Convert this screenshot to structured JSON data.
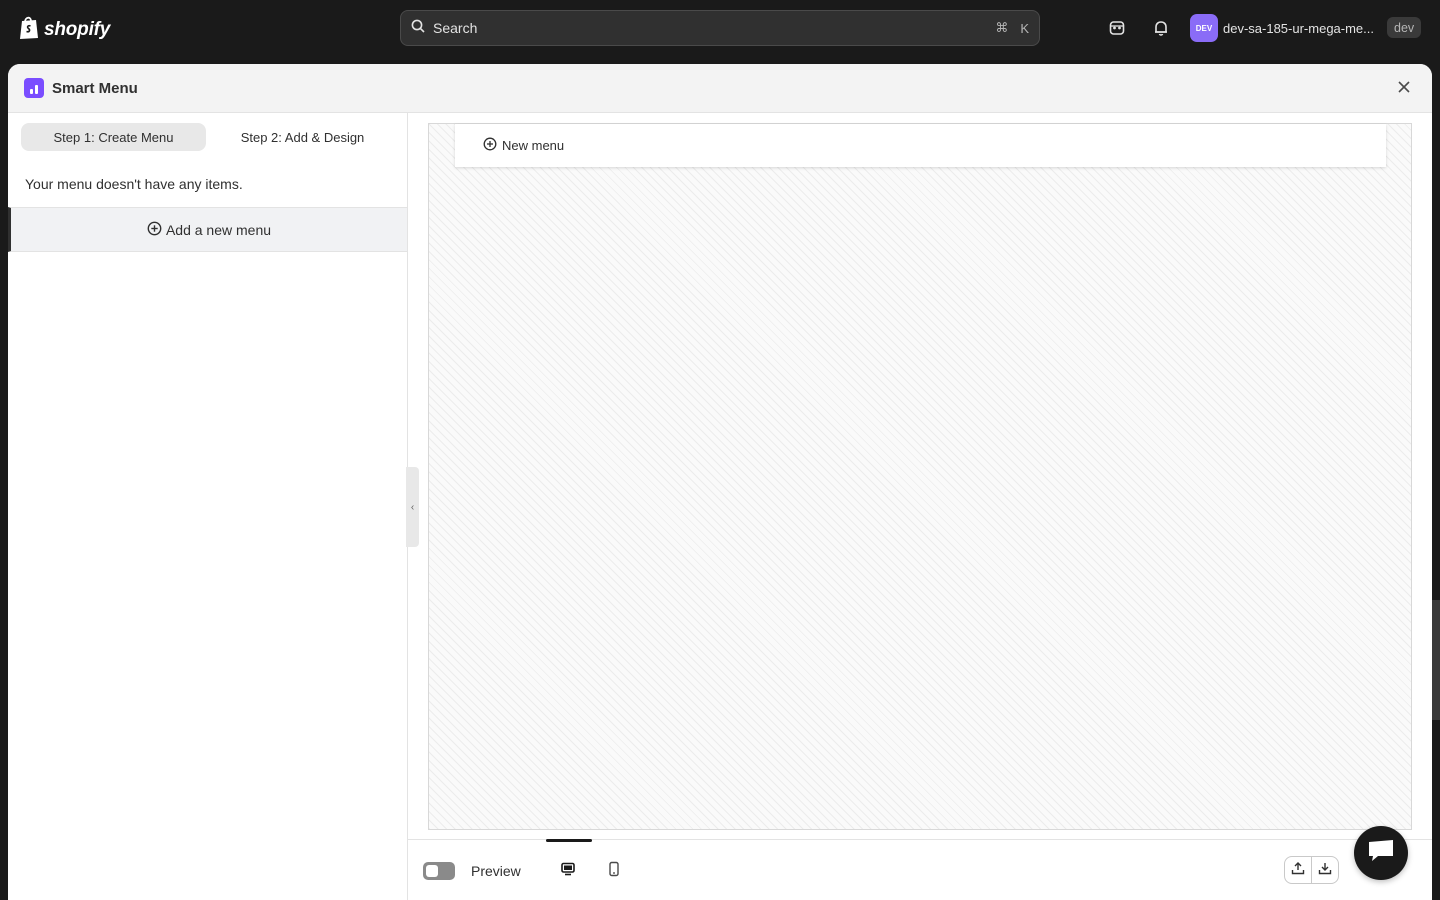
{
  "topbar": {
    "logo_text": "shopify",
    "search_placeholder": "Search",
    "shortcut_cmd": "⌘",
    "shortcut_key": "K",
    "avatar_text": "DEV",
    "store_name": "dev-sa-185-ur-mega-me...",
    "env_badge": "dev"
  },
  "modal": {
    "title": "Smart Menu",
    "steps": [
      {
        "label": "Step 1: Create Menu",
        "active": true
      },
      {
        "label": "Step 2: Add & Design",
        "active": false
      }
    ],
    "empty_message": "Your menu doesn't have any items.",
    "add_menu_label": "Add a new menu",
    "collapse_glyph": "‹"
  },
  "canvas": {
    "new_menu_label": "New menu"
  },
  "footer": {
    "preview_label": "Preview",
    "preview_on": false,
    "selected_device": "desktop"
  },
  "colors": {
    "topbar_bg": "#1a1a1a",
    "app_icon": "#7a4dff",
    "avatar": "#8a6cf7"
  },
  "icons": [
    "shopify-bag-icon",
    "search-icon",
    "inbox-icon",
    "bell-icon",
    "close-icon",
    "plus-circle-icon",
    "desktop-icon",
    "mobile-icon",
    "upload-icon",
    "download-icon",
    "chat-icon"
  ]
}
